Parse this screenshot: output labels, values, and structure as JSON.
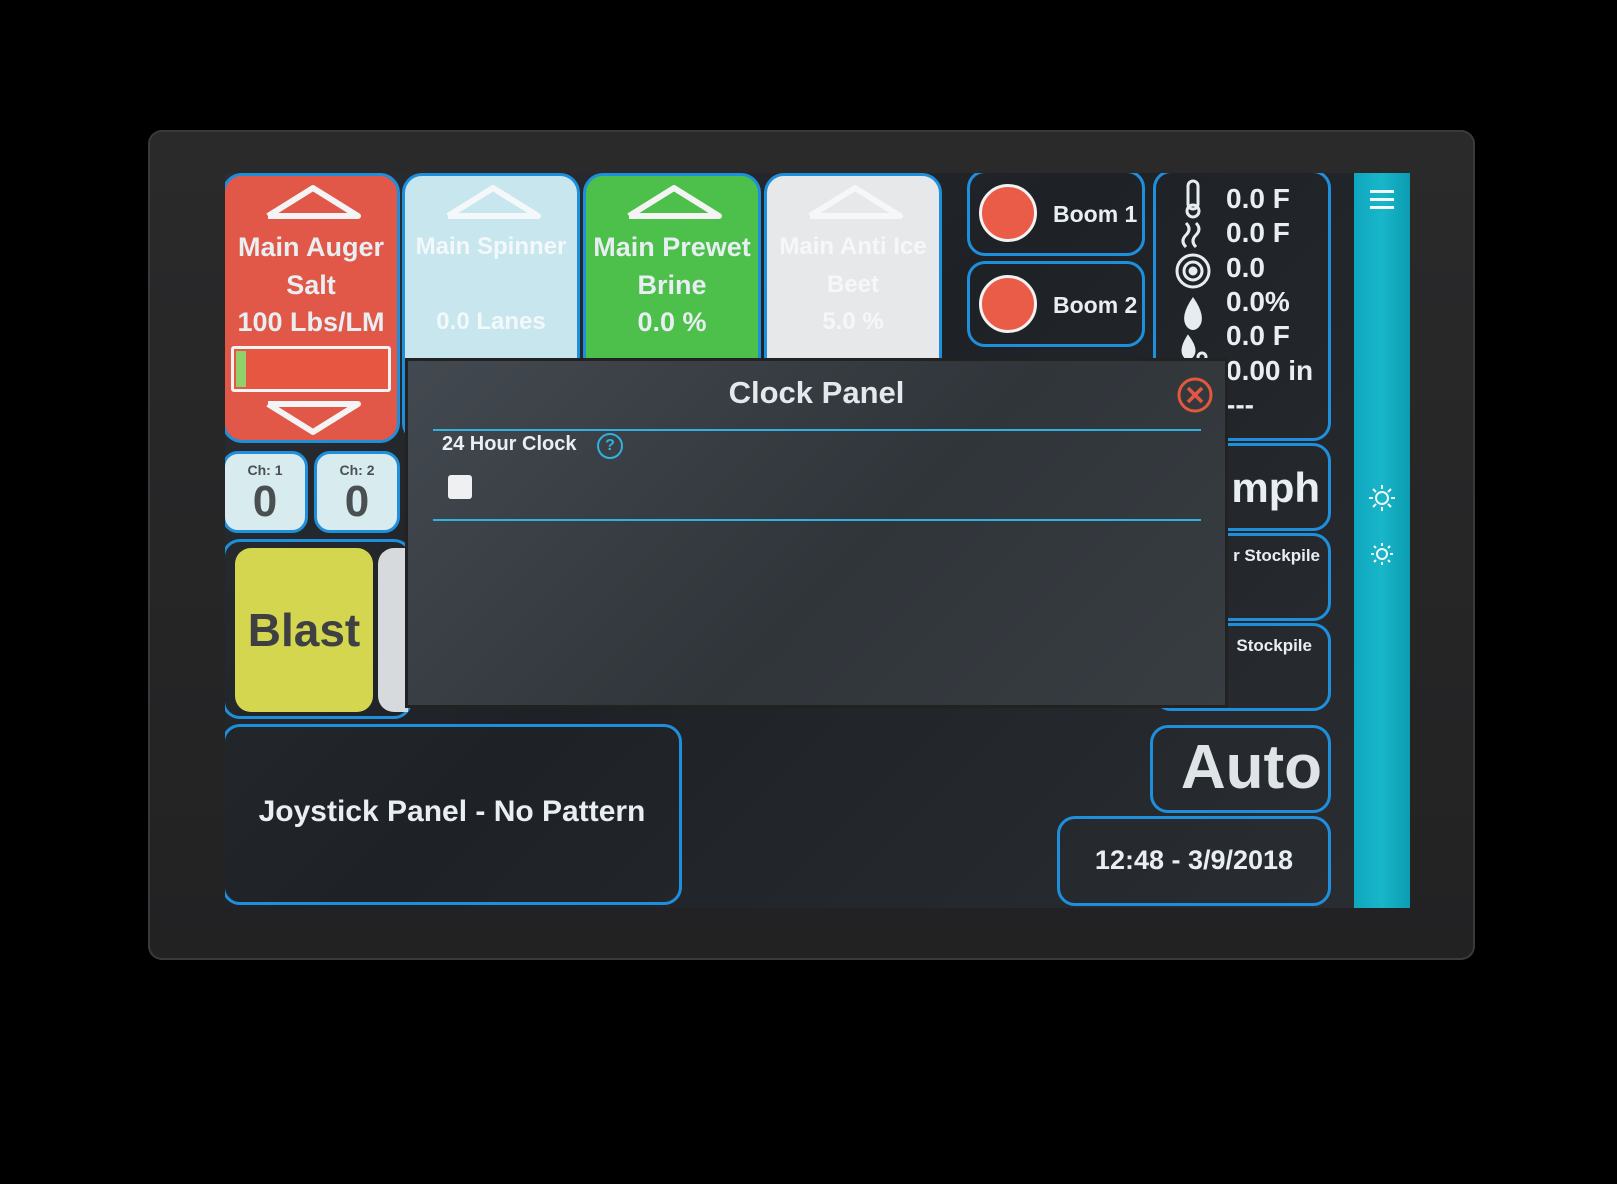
{
  "controls": [
    {
      "name": "main-auger",
      "title1": "Main Auger",
      "title2": "Salt",
      "value": "100 Lbs/LM",
      "bg": "#e15848"
    },
    {
      "name": "main-spinner",
      "title1": "Main Spinner",
      "title2": "",
      "value": "0.0 Lanes",
      "bg": "#c8e6ee"
    },
    {
      "name": "main-prewet",
      "title1": "Main Prewet",
      "title2": "Brine",
      "value": "0.0 %",
      "bg": "#4cc04a"
    },
    {
      "name": "main-anti-ice",
      "title1": "Main Anti Ice",
      "title2": "Beet",
      "value": "5.0 %",
      "bg": "#e6e8ea"
    }
  ],
  "channels": [
    {
      "label": "Ch: 1",
      "value": "0"
    },
    {
      "label": "Ch: 2",
      "value": "0"
    }
  ],
  "booms": [
    "Boom 1",
    "Boom 2"
  ],
  "sensors": [
    "0.0 F",
    "0.0 F",
    "0.0",
    "0.0%",
    "0.0 F",
    "0.00 in",
    "---"
  ],
  "speed_unit": "mph",
  "stockpiles": [
    "r Stockpile",
    "Stockpile"
  ],
  "blast_label": "Blast",
  "joystick_label": "Joystick Panel - No Pattern",
  "auto_label": "Auto",
  "datetime": "12:48 - 3/9/2018",
  "modal": {
    "title": "Clock Panel",
    "option_label": "24 Hour Clock",
    "help_glyph": "?",
    "checkbox_checked": false
  },
  "icons": {
    "menu": "menu-icon",
    "brightness_up": "brightness-up-icon",
    "brightness_down": "brightness-down-icon",
    "close": "close-icon"
  },
  "colors": {
    "accent": "#1f8fdc",
    "sidebar": "#18b6c9",
    "alert": "#ea5c47",
    "blast": "#d4d64f"
  }
}
